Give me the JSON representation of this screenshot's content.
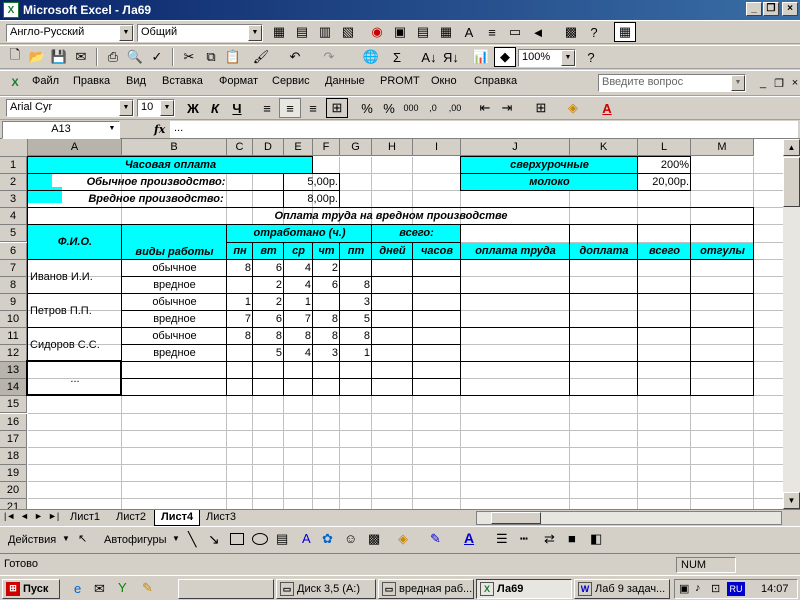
{
  "window": {
    "title": "Microsoft Excel - Ла69",
    "app_icon": "X"
  },
  "toolbar1": {
    "language": "Англо-Русский",
    "format": "Общий"
  },
  "toolbar2": {
    "zoom": "100%"
  },
  "menu": {
    "items": [
      "Файл",
      "Правка",
      "Вид",
      "Вставка",
      "Формат",
      "Сервис",
      "Данные",
      "PROMT",
      "Окно",
      "Справка"
    ],
    "ask_placeholder": "Введите вопрос"
  },
  "format_bar": {
    "font": "Arial Cyr",
    "size": "10",
    "bold": "Ж",
    "italic": "К",
    "underline": "Ч"
  },
  "formula_bar": {
    "cell_ref": "A13",
    "fx": "fx",
    "content": "..."
  },
  "columns": [
    "A",
    "B",
    "C",
    "D",
    "E",
    "F",
    "G",
    "H",
    "I",
    "J",
    "K",
    "L",
    "M"
  ],
  "rows": [
    "1",
    "2",
    "3",
    "4",
    "5",
    "6",
    "7",
    "8",
    "9",
    "10",
    "11",
    "12",
    "13",
    "14",
    "15",
    "16",
    "17",
    "18",
    "19",
    "20",
    "21"
  ],
  "sheet": {
    "hourly": "Часовая оплата",
    "normal_prod": "Обычное производство:",
    "normal_val": "5,00р.",
    "hazard_prod": "Вредное производство:",
    "hazard_val": "8,00р.",
    "overtime": "сверхурочные",
    "overtime_val": "200%",
    "milk": "молоко",
    "milk_val": "20,00р.",
    "header_title": "Оплата труда на вредном производстве",
    "fio": "Ф.И.О.",
    "work_types": "виды работы",
    "worked": "отработано (ч.)",
    "total": "всего:",
    "days": [
      "пн",
      "вт",
      "ср",
      "чт",
      "пт"
    ],
    "col_days": "дней",
    "col_hours": "часов",
    "col_pay": "оплата труда",
    "col_extra": "доплата",
    "col_all": "всего",
    "col_leave": "отгулы",
    "employees": [
      {
        "name": "Иванов И.И.",
        "rows": [
          {
            "type": "обычное",
            "v": [
              "8",
              "6",
              "4",
              "2",
              ""
            ]
          },
          {
            "type": "вредное",
            "v": [
              "",
              "2",
              "4",
              "6",
              "8"
            ]
          }
        ]
      },
      {
        "name": "Петров П.П.",
        "rows": [
          {
            "type": "обычное",
            "v": [
              "1",
              "2",
              "1",
              "",
              "3"
            ]
          },
          {
            "type": "вредное",
            "v": [
              "7",
              "6",
              "7",
              "8",
              "5"
            ]
          }
        ]
      },
      {
        "name": "Сидоров С.С.",
        "rows": [
          {
            "type": "обычное",
            "v": [
              "8",
              "8",
              "8",
              "8",
              "8"
            ]
          },
          {
            "type": "вредное",
            "v": [
              "",
              "5",
              "4",
              "3",
              "1"
            ]
          }
        ]
      }
    ],
    "ellipsis": "..."
  },
  "sheet_tabs": [
    "Лист1",
    "Лист2",
    "Лист4",
    "Лист3"
  ],
  "active_tab": "Лист4",
  "draw_bar": {
    "actions": "Действия",
    "autoshapes": "Автофигуры"
  },
  "status": {
    "ready": "Готово",
    "num": "NUM"
  },
  "taskbar": {
    "start": "Пуск",
    "tasks": [
      "Диск 3,5 (A:)",
      "вредная раб...",
      "Ла69",
      "Лаб 9 задач..."
    ],
    "lang": "RU",
    "time": "14:07"
  },
  "colors": {
    "cyan": "#00ffff",
    "titlebar": "#0a246a"
  }
}
